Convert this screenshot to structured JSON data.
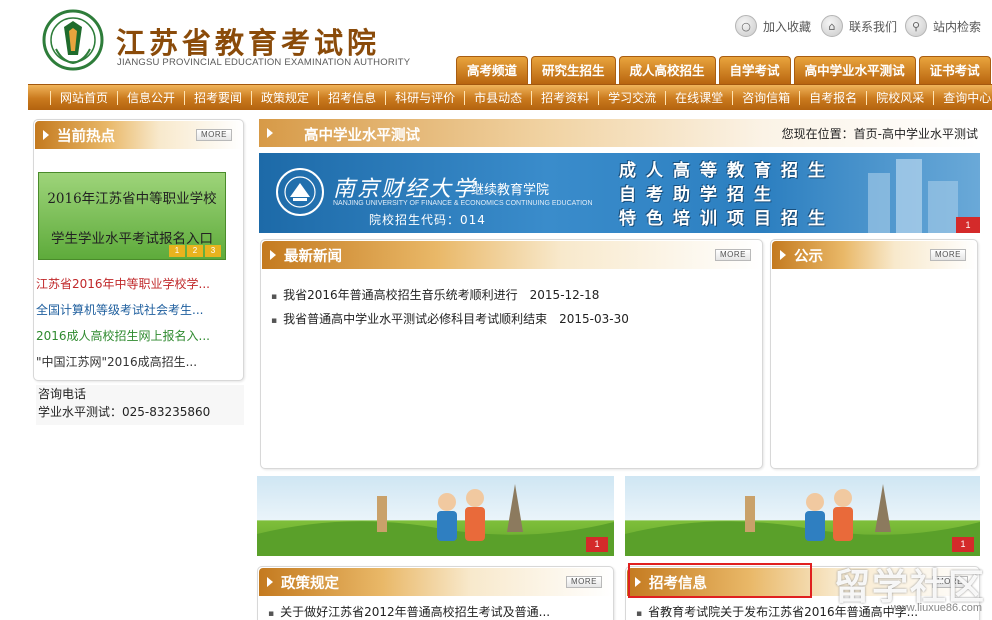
{
  "header": {
    "logo_cn": "江苏省教育考试院",
    "logo_en": "JIANGSU PROVINCIAL EDUCATION EXAMINATION AUTHORITY",
    "utils": [
      {
        "label": "加入收藏",
        "icon": "bookmark-icon"
      },
      {
        "label": "联系我们",
        "icon": "home-icon"
      },
      {
        "label": "站内检索",
        "icon": "search-icon"
      }
    ],
    "tabs": [
      "高考频道",
      "研究生招生",
      "成人高校招生",
      "自学考试",
      "高中学业水平测试",
      "证书考试"
    ]
  },
  "nav": {
    "items": [
      "网站首页",
      "信息公开",
      "招考要闻",
      "政策规定",
      "招考信息",
      "科研与评价",
      "市县动态",
      "招考资料",
      "学习交流",
      "在线课堂",
      "咨询信箱",
      "自考报名",
      "院校风采",
      "查询中心"
    ]
  },
  "hot": {
    "title": "当前热点",
    "more": "MORE",
    "banner_line1": "2016年江苏省中等职业学校",
    "banner_line2": "学生学业水平考试报名入口",
    "banner_nums": [
      "1",
      "2",
      "3"
    ],
    "items": [
      {
        "text": "江苏省2016年中等职业学校学...",
        "color": "#c0282a"
      },
      {
        "text": "全国计算机等级考试社会考生...",
        "color": "#1f5f9e"
      },
      {
        "text": "2016成人高校招生网上报名入...",
        "color": "#2f8a2f"
      },
      {
        "text": "\"中国江苏网\"2016成高招生...",
        "color": "#333333"
      }
    ]
  },
  "contact": {
    "title": "咨询电话",
    "line": "学业水平测试：025-83235860"
  },
  "page": {
    "title": "高中学业水平测试",
    "breadcrumb": "您现在位置：首页-高中学业水平测试"
  },
  "ad": {
    "school": "南京财经大学",
    "sub": "继续教育学院",
    "en": "NANJING UNIVERSITY OF FINANCE & ECONOMICS CONTINUING EDUCATION",
    "code": "院校招生代码：014",
    "lines": [
      "成人高等教育招生",
      "自考助学招生",
      "特色培训项目招生"
    ],
    "num": "1"
  },
  "news": {
    "title": "最新新闻",
    "more": "MORE",
    "items": [
      {
        "text": "我省2016年普通高校招生音乐统考顺利进行",
        "date": "2015-12-18"
      },
      {
        "text": "我省普通高中学业水平测试必修科目考试顺利结束",
        "date": "2015-03-30"
      }
    ]
  },
  "notice": {
    "title": "公示",
    "more": "MORE"
  },
  "pic_banners": [
    {
      "num": "1"
    },
    {
      "num": "1"
    }
  ],
  "policy": {
    "title": "政策规定",
    "more": "MORE",
    "items": [
      "关于做好江苏省2012年普通高校招生考试及普通..."
    ]
  },
  "recruit": {
    "title": "招考信息",
    "more": "MORE",
    "items": [
      "省教育考试院关于发布江苏省2016年普通高中学..."
    ]
  },
  "watermark": {
    "text": "留学社区",
    "url": "www.liuxue86.com"
  }
}
